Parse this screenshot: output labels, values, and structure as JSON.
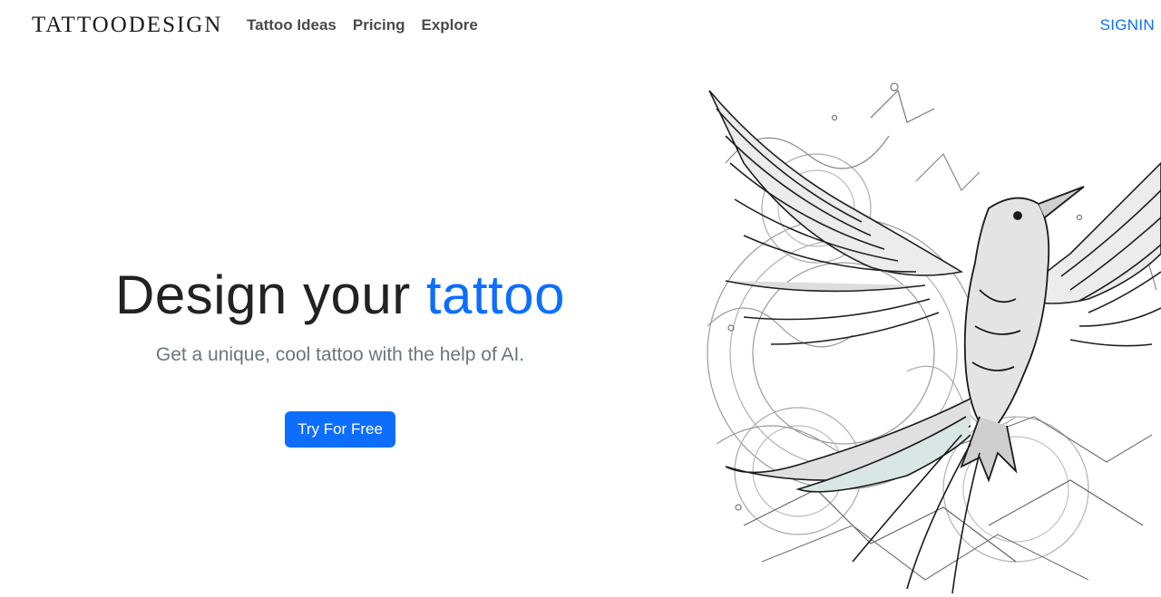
{
  "header": {
    "brand": "TATTOODESIGN",
    "nav": [
      {
        "label": "Tattoo Ideas"
      },
      {
        "label": "Pricing"
      },
      {
        "label": "Explore"
      }
    ],
    "signin_label": "SIGNIN"
  },
  "hero": {
    "title_main": "Design your",
    "title_accent": "tattoo",
    "subtitle": "Get a unique, cool tattoo with the help of AI.",
    "cta_label": "Try For Free"
  },
  "illustration": {
    "icon": "bird-tattoo-illustration"
  },
  "colors": {
    "accent": "#0d6efd",
    "text_dark": "#222222",
    "text_muted": "#6c757d",
    "nav_text": "#4a4a4a"
  }
}
